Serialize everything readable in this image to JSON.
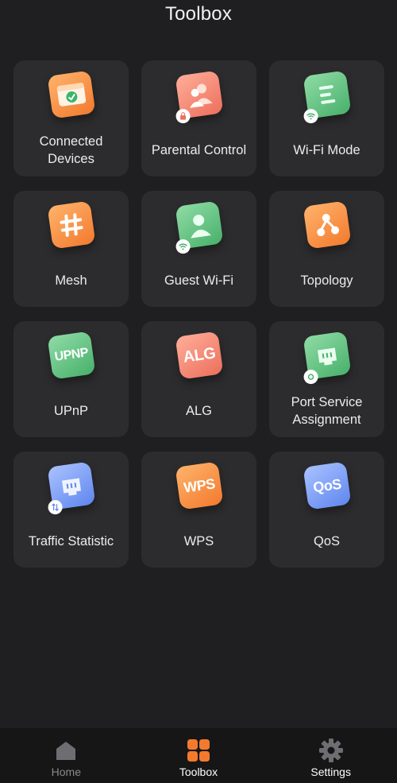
{
  "header": {
    "title": "Toolbox"
  },
  "tiles": [
    {
      "label": "Connected Devices",
      "icon": "connected-devices-icon",
      "color": "#f27a2e"
    },
    {
      "label": "Parental Control",
      "icon": "parental-control-icon",
      "color": "#ec6f5c"
    },
    {
      "label": "Wi-Fi Mode",
      "icon": "wifi-mode-icon",
      "color": "#48b06a"
    },
    {
      "label": "Mesh",
      "icon": "mesh-icon",
      "color": "#f27a2e"
    },
    {
      "label": "Guest Wi-Fi",
      "icon": "guest-wifi-icon",
      "color": "#48b06a"
    },
    {
      "label": "Topology",
      "icon": "topology-icon",
      "color": "#f27a2e"
    },
    {
      "label": "UPnP",
      "icon": "upnp-icon",
      "icon_text": "UPNP",
      "color": "#48b06a"
    },
    {
      "label": "ALG",
      "icon": "alg-icon",
      "icon_text": "ALG",
      "color": "#ec6f5c"
    },
    {
      "label": "Port Service Assignment",
      "icon": "port-service-icon",
      "color": "#48b06a"
    },
    {
      "label": "Traffic Statistic",
      "icon": "traffic-statistic-icon",
      "color": "#5f86ee"
    },
    {
      "label": "WPS",
      "icon": "wps-icon",
      "icon_text": "WPS",
      "color": "#f27a2e"
    },
    {
      "label": "QoS",
      "icon": "qos-icon",
      "icon_text": "QoS",
      "color": "#5f86ee"
    }
  ],
  "tabbar": {
    "home": {
      "label": "Home",
      "icon": "home-icon",
      "color": "#8a8a8c"
    },
    "toolbox": {
      "label": "Toolbox",
      "icon": "toolbox-grid-icon",
      "color": "#f27a2e"
    },
    "settings": {
      "label": "Settings",
      "icon": "gear-icon",
      "color": "#8a8a8c"
    }
  }
}
